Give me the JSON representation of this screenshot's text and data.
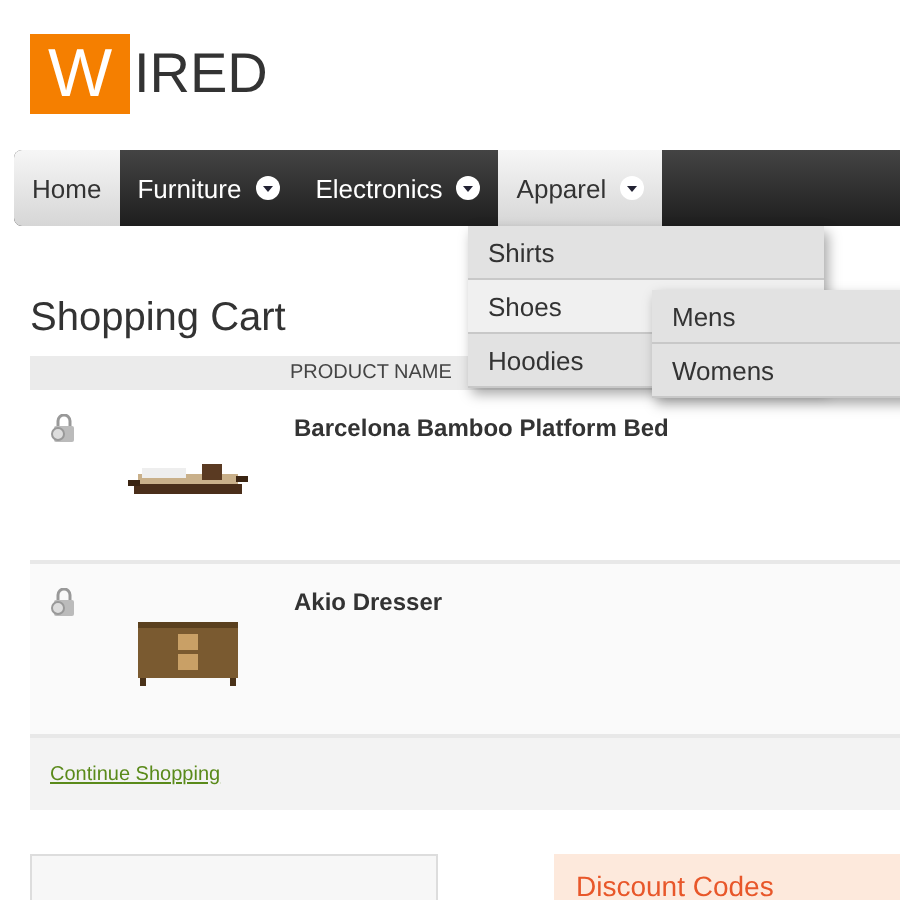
{
  "logo": {
    "letter": "W",
    "rest": "IRED"
  },
  "nav": [
    {
      "label": "Home",
      "selected": true,
      "dropdown": false
    },
    {
      "label": "Furniture",
      "selected": false,
      "dropdown": true
    },
    {
      "label": "Electronics",
      "selected": false,
      "dropdown": true
    },
    {
      "label": "Apparel",
      "selected": true,
      "dropdown": true
    }
  ],
  "menu": [
    {
      "label": "Shirts",
      "selected": false
    },
    {
      "label": "Shoes",
      "selected": true
    },
    {
      "label": "Hoodies",
      "selected": false
    }
  ],
  "submenu": [
    {
      "label": "Mens"
    },
    {
      "label": "Womens"
    }
  ],
  "title": "Shopping Cart",
  "table": {
    "columns": [
      "PRODUCT NAME"
    ],
    "rows": [
      {
        "name": "Barcelona Bamboo Platform Bed",
        "kind": "bed"
      },
      {
        "name": "Akio Dresser",
        "kind": "dresser"
      }
    ]
  },
  "continue_link": "Continue Shopping",
  "discount": {
    "title": "Discount Codes"
  }
}
